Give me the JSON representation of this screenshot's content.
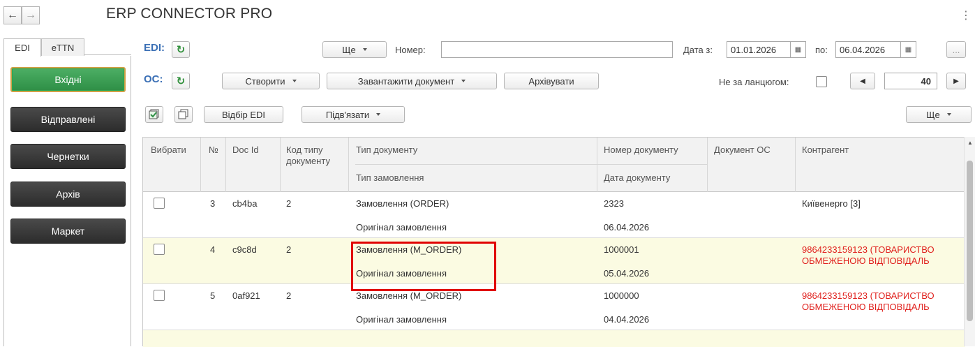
{
  "header": {
    "title": "ERP CONNECTOR PRO",
    "back": "←",
    "forward": "→",
    "menu": "⋮"
  },
  "tabs": [
    {
      "label": "EDI"
    },
    {
      "label": "eTTN"
    }
  ],
  "sidebar": {
    "items": [
      {
        "label": "Вхідні",
        "active": true
      },
      {
        "label": "Відправлені"
      },
      {
        "label": "Чернетки"
      },
      {
        "label": "Архів"
      },
      {
        "label": "Маркет"
      }
    ]
  },
  "edi_bar": {
    "label": "EDI:",
    "more_label": "Ще",
    "number_label": "Номер:",
    "number_value": "",
    "date_from_label": "Дата з:",
    "date_from": "01.01.2026",
    "date_to_label": "по:",
    "date_to": "06.04.2026",
    "ellipsis": "..."
  },
  "oc_bar": {
    "label": "ОС:",
    "create_label": "Створити",
    "load_label": "Завантажити документ",
    "archive_label": "Архівувати",
    "not_chain_label": "Не за ланцюгом:",
    "page_number": "40"
  },
  "toolbar3": {
    "filter_label": "Відбір EDI",
    "link_label": "Підв'язати",
    "more_label": "Ще"
  },
  "table": {
    "columns": {
      "select": "Вибрати",
      "num": "№",
      "doc_id": "Doc Id",
      "type_code": "Код типу документу",
      "doc_type": "Тип документу",
      "order_type": "Тип замовлення",
      "doc_number": "Номер документу",
      "doc_date": "Дата документу",
      "oc_doc": "Документ ОС",
      "counterparty": "Контрагент"
    },
    "rows": [
      {
        "num": "3",
        "doc_id": "cb4ba",
        "type_code": "2",
        "doc_type": "Замовлення (ORDER)",
        "order_type": "Оригінал замовлення",
        "doc_number": "2323",
        "doc_date": "06.04.2026",
        "counterparty_1": "Київенерго [3]",
        "counterparty_2": ""
      },
      {
        "num": "4",
        "doc_id": "c9c8d",
        "type_code": "2",
        "doc_type": "Замовлення (M_ORDER)",
        "order_type": "Оригінал замовлення",
        "doc_number": "1000001",
        "doc_date": "05.04.2026",
        "counterparty_1": "9864233159123 (ТОВАРИСТВО",
        "counterparty_2": "ОБМЕЖЕНОЮ ВІДПОВІДАЛЬ"
      },
      {
        "num": "5",
        "doc_id": "0af921",
        "type_code": "2",
        "doc_type": "Замовлення (M_ORDER)",
        "order_type": "Оригінал замовлення",
        "doc_number": "1000000",
        "doc_date": "04.04.2026",
        "counterparty_1": "9864233159123 (ТОВАРИСТВО",
        "counterparty_2": "ОБМЕЖЕНОЮ ВІДПОВІДАЛЬ"
      }
    ]
  },
  "colors": {
    "accent_blue": "#3a6fb5",
    "active_green": "#2e8f46",
    "error_red": "#e0211d",
    "highlight_red": "#e00000",
    "selected_row": "#fbfbe2"
  }
}
